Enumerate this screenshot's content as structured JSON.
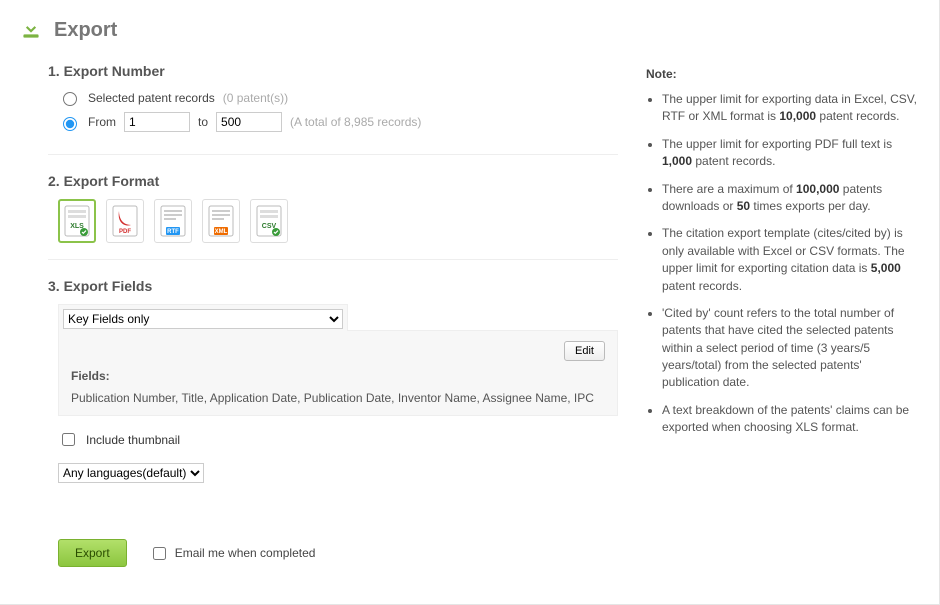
{
  "header": {
    "title": "Export"
  },
  "sec1": {
    "title": "1. Export Number",
    "opt_selected_label": "Selected patent records",
    "opt_selected_count": "(0 patent(s))",
    "opt_from_label": "From",
    "from_value": "1",
    "to_label": "to",
    "to_value": "500",
    "total_label": "(A total of 8,985 records)"
  },
  "sec2": {
    "title": "2. Export Format",
    "formats": [
      {
        "id": "xls",
        "label": "XLS",
        "selected": true
      },
      {
        "id": "pdf",
        "label": "PDF",
        "selected": false
      },
      {
        "id": "rtf",
        "label": "RTF",
        "selected": false
      },
      {
        "id": "xml",
        "label": "XML",
        "selected": false
      },
      {
        "id": "csv",
        "label": "CSV",
        "selected": false
      }
    ]
  },
  "sec3": {
    "title": "3. Export Fields",
    "select_value": "Key Fields only",
    "edit_label": "Edit",
    "fields_label": "Fields:",
    "fields_value": "Publication Number, Title, Application Date, Publication Date, Inventor Name, Assignee Name, IPC",
    "thumb_label": "Include thumbnail",
    "lang_value": "Any languages(default)"
  },
  "actions": {
    "export_label": "Export",
    "email_label": "Email me when completed"
  },
  "notes": {
    "title": "Note:",
    "items": [
      "The upper limit for exporting data in Excel, CSV, RTF or XML format is <b>10,000</b> patent records.",
      "The upper limit for exporting PDF full text is <b>1,000</b> patent records.",
      "There are a maximum of <b>100,000</b> patents downloads or <b>50</b> times exports per day.",
      "The citation export template (cites/cited by) is only available with Excel or CSV formats. The upper limit for exporting citation data is <b>5,000</b> patent records.",
      "'Cited by' count refers to the total number of patents that have cited the selected patents within a select period of time (3 years/5 years/total) from the selected patents' publication date.",
      "A text breakdown of the patents' claims can be exported when choosing XLS format."
    ]
  }
}
